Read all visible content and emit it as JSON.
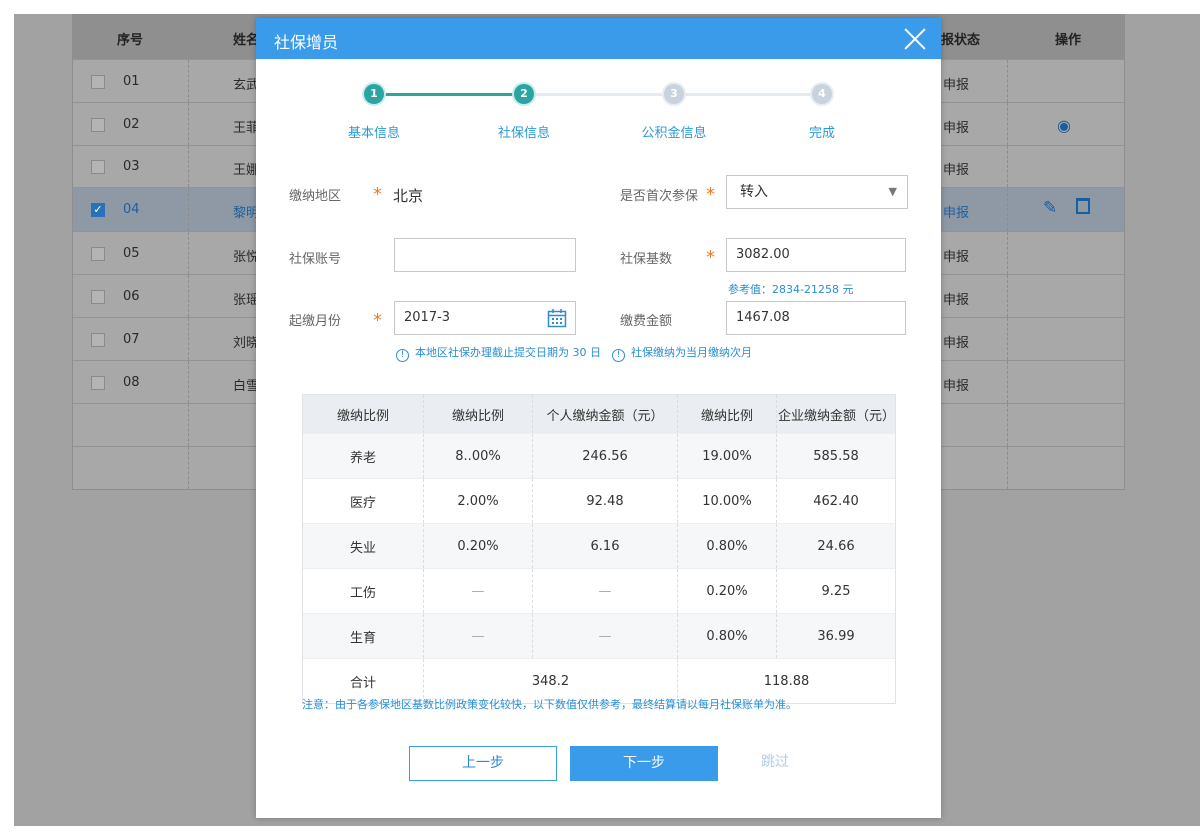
{
  "background_table": {
    "headers": {
      "index": "序号",
      "name": "姓名",
      "status": "申报状态",
      "action": "操作"
    },
    "rows": [
      {
        "no": "01",
        "name": "玄武",
        "status": "申报",
        "checked": false
      },
      {
        "no": "02",
        "name": "王菲",
        "status": "申报",
        "checked": false
      },
      {
        "no": "03",
        "name": "王娜",
        "status": "申报",
        "checked": false
      },
      {
        "no": "04",
        "name": "黎明",
        "status": "申报",
        "checked": true
      },
      {
        "no": "05",
        "name": "张悦",
        "status": "申报",
        "checked": false
      },
      {
        "no": "06",
        "name": "张瑶",
        "status": "申报",
        "checked": false
      },
      {
        "no": "07",
        "name": "刘晓",
        "status": "申报",
        "checked": false
      },
      {
        "no": "08",
        "name": "白雪",
        "status": "申报",
        "checked": false
      }
    ]
  },
  "modal": {
    "title": "社保增员",
    "steps": [
      {
        "num": "1",
        "label": "基本信息",
        "state": "done"
      },
      {
        "num": "2",
        "label": "社保信息",
        "state": "done"
      },
      {
        "num": "3",
        "label": "公积金信息",
        "state": "todo"
      },
      {
        "num": "4",
        "label": "完成",
        "state": "todo"
      }
    ],
    "form": {
      "region_label": "缴纳地区",
      "region_value": "北京",
      "first_insure_label": "是否首次参保",
      "first_insure_value": "转入",
      "account_label": "社保账号",
      "account_value": "",
      "base_label": "社保基数",
      "base_value": "3082.00",
      "base_reference": "参考值：2834-21258 元",
      "start_month_label": "起缴月份",
      "start_month_value": "2017-3",
      "fee_label": "缴费金额",
      "fee_value": "1467.08",
      "hint_deadline": "本地区社保办理截止提交日期为 30 日",
      "hint_month": "社保缴纳为当月缴纳次月"
    },
    "table": {
      "headers": [
        "缴纳比例",
        "缴纳比例",
        "个人缴纳金额（元）",
        "缴纳比例",
        "企业缴纳金额（元）"
      ],
      "rows": [
        [
          "养老",
          "8..00%",
          "246.56",
          "19.00%",
          "585.58"
        ],
        [
          "医疗",
          "2.00%",
          "92.48",
          "10.00%",
          "462.40"
        ],
        [
          "失业",
          "0.20%",
          "6.16",
          "0.80%",
          "24.66"
        ],
        [
          "工伤",
          "—",
          "—",
          "0.20%",
          "9.25"
        ],
        [
          "生育",
          "—",
          "—",
          "0.80%",
          "36.99"
        ]
      ],
      "total_label": "合计",
      "total_personal": "348.2",
      "total_company": "118.88"
    },
    "note": "注意：由于各参保地区基数比例政策变化较快，以下数值仅供参考，最终结算请以每月社保账单为准。",
    "buttons": {
      "prev": "上一步",
      "next": "下一步",
      "skip": "跳过"
    }
  },
  "colors": {
    "primary": "#3a9bea",
    "step_done": "#2aa5a2",
    "required": "#f07a2b",
    "hint": "#2a8ecf"
  }
}
